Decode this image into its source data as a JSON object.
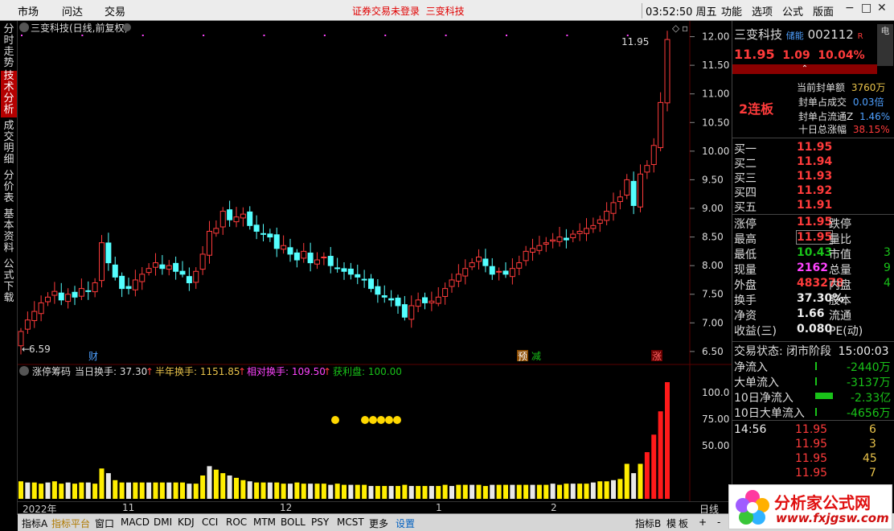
{
  "topbar": {
    "menus": [
      "市场",
      "问达",
      "交易"
    ],
    "notice": "证券交易未登录",
    "notice_stock": "三变科技",
    "clock": "03:52:50 周五",
    "right_menus": [
      "功能",
      "选项",
      "公式",
      "版面"
    ]
  },
  "left_tabs": [
    "分时走势",
    "技术分析",
    "成交明细",
    "分价表",
    "基本资料",
    "公式下载"
  ],
  "chart_header": {
    "title": "三变科技(日线,前复权)"
  },
  "price_axis": [
    "12.00",
    "11.50",
    "11.00",
    "10.50",
    "10.00",
    "9.50",
    "9.00",
    "8.50",
    "8.00",
    "7.50",
    "7.00",
    "6.50"
  ],
  "annotations": {
    "high": "11.95",
    "low": "6.59",
    "markers": [
      "财",
      "预",
      "减",
      "涨"
    ]
  },
  "indicator": {
    "name": "涨停筹码",
    "today_label": "当日换手: 37.30",
    "half_label": "半年换手: 1151.85",
    "rel_label": "相对换手: 109.50",
    "profit_label": "获利盘: 100.00",
    "axis": [
      "100.0",
      "75.00",
      "50.00"
    ]
  },
  "date_axis": [
    "2022年",
    "11",
    "12",
    "1",
    "2"
  ],
  "bottom_tabs": [
    "指标A",
    "指标平台",
    "窗口",
    "MACD",
    "DMI",
    "KDJ",
    "CCI",
    "ROC",
    "MTM",
    "BOLL",
    "PSY",
    "MCST",
    "更多",
    "设置"
  ],
  "bottom_right": [
    "指标B",
    "模",
    "板",
    "+",
    "-",
    "日线"
  ],
  "quote": {
    "name": "三变科技",
    "tag": "储能",
    "code": "002112",
    "r": "R",
    "price": "11.95",
    "change": "1.09",
    "pct": "10.04%",
    "streak": "2连板",
    "seal_rows": [
      {
        "label": "当前封单额",
        "value": "3760万"
      },
      {
        "label": "封单占成交",
        "value": "0.03倍"
      },
      {
        "label": "封单占流通Z",
        "value": "1.46%"
      },
      {
        "label": "十日总涨幅",
        "value": "38.15%"
      }
    ],
    "bids": [
      {
        "label": "买一",
        "price": "11.95"
      },
      {
        "label": "买二",
        "price": "11.94"
      },
      {
        "label": "买三",
        "price": "11.93"
      },
      {
        "label": "买四",
        "price": "11.92"
      },
      {
        "label": "买五",
        "price": "11.91"
      }
    ],
    "stats": [
      {
        "l1": "涨停",
        "v1": "11.95",
        "l2": "跌停",
        "v2": ""
      },
      {
        "l1": "最高",
        "v1": "11.95",
        "l2": "量比",
        "v2": ""
      },
      {
        "l1": "最低",
        "v1": "10.43",
        "l2": "市值",
        "v2": "3"
      },
      {
        "l1": "现量",
        "v1": "2162",
        "l2": "总量",
        "v2": "9"
      },
      {
        "l1": "外盘",
        "v1": "483278",
        "l2": "内盘",
        "v2": "4"
      },
      {
        "l1": "换手",
        "v1": "37.30%",
        "l2": "股本",
        "v2": ""
      },
      {
        "l1": "净资",
        "v1": "1.66",
        "l2": "流通",
        "v2": ""
      },
      {
        "l1": "收益(三)",
        "v1": "0.080",
        "l2": "PE(动)",
        "v2": ""
      }
    ],
    "trade_status": "交易状态: 闭市阶段",
    "trade_time": "15:00:03",
    "flows": [
      {
        "label": "净流入",
        "value": "-2440万"
      },
      {
        "label": "大单流入",
        "value": "-3137万"
      },
      {
        "label": "10日净流入",
        "value": "-2.33亿"
      },
      {
        "label": "10日大单流入",
        "value": "-4656万"
      }
    ],
    "ticks": [
      {
        "time": "14:56",
        "price": "11.95",
        "vol": "6"
      },
      {
        "time": "",
        "price": "11.95",
        "vol": "3"
      },
      {
        "time": "",
        "price": "11.95",
        "vol": "45"
      },
      {
        "time": "",
        "price": "11.95",
        "vol": "7"
      }
    ]
  },
  "logo": {
    "title": "分析家公式网",
    "url": "www.fxjgsw.com"
  },
  "chart_data": {
    "type": "candlestick",
    "title": "三变科技(日线,前复权)",
    "ylim": [
      6.4,
      12.05
    ],
    "closes": [
      6.85,
      7.05,
      7.2,
      7.35,
      7.45,
      7.55,
      7.4,
      7.5,
      7.45,
      7.6,
      7.55,
      7.7,
      8.4,
      8.05,
      7.8,
      7.6,
      7.6,
      7.75,
      7.85,
      7.95,
      8.05,
      7.95,
      8.0,
      7.9,
      7.85,
      7.7,
      7.9,
      8.2,
      8.6,
      8.65,
      8.95,
      8.8,
      8.85,
      8.9,
      8.7,
      8.6,
      8.55,
      8.5,
      8.3,
      8.35,
      8.2,
      8.1,
      8.25,
      8.05,
      8.1,
      8.15,
      8.0,
      7.95,
      7.9,
      7.85,
      7.8,
      7.75,
      7.6,
      7.5,
      7.45,
      7.4,
      7.3,
      7.1,
      7.3,
      7.4,
      7.35,
      7.38,
      7.45,
      7.6,
      7.75,
      7.85,
      7.95,
      8.05,
      8.15,
      8.0,
      7.85,
      7.9,
      7.85,
      7.95,
      8.05,
      8.25,
      8.3,
      8.35,
      8.4,
      8.45,
      8.5,
      8.45,
      8.55,
      8.6,
      8.65,
      8.7,
      8.8,
      8.95,
      9.1,
      9.2,
      9.5,
      9.05,
      9.6,
      9.75,
      10.1,
      10.85,
      11.95
    ],
    "volume_series": [
      {
        "name": "涨停筹码",
        "values": [
          15,
          14,
          14,
          13,
          14,
          15,
          13,
          14,
          13,
          14,
          14,
          13,
          26,
          22,
          16,
          14,
          14,
          14,
          14,
          14,
          14,
          14,
          14,
          14,
          14,
          13,
          13,
          20,
          28,
          25,
          22,
          20,
          18,
          16,
          15,
          14,
          14,
          14,
          14,
          13,
          13,
          14,
          13,
          13,
          13,
          13,
          12,
          13,
          12,
          12,
          12,
          12,
          11,
          11,
          11,
          11,
          11,
          12,
          11,
          11,
          11,
          11,
          11,
          12,
          11,
          12,
          12,
          12,
          12,
          11,
          12,
          12,
          12,
          12,
          12,
          12,
          12,
          12,
          12,
          13,
          12,
          13,
          13,
          13,
          13,
          14,
          15,
          15,
          16,
          17,
          30,
          22,
          30,
          40,
          55,
          75,
          100
        ]
      }
    ]
  }
}
